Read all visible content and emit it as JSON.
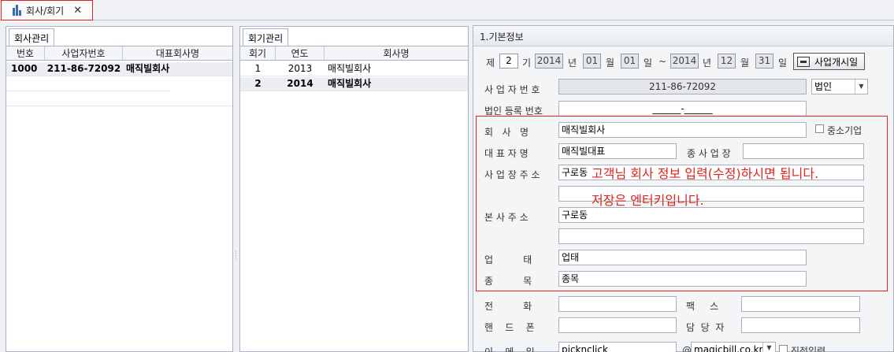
{
  "tab": {
    "label": "회사/회기",
    "close": "✕"
  },
  "company_panel": {
    "tab_label": "회사관리",
    "headers": [
      "번호",
      "사업자번호",
      "대표회사명"
    ],
    "rows": [
      {
        "no": "1000",
        "bizno": "211-86-72092",
        "name": "매직빌회사"
      }
    ]
  },
  "period_panel": {
    "tab_label": "회기관리",
    "headers": [
      "회기",
      "연도",
      "회사명"
    ],
    "rows": [
      {
        "period": "1",
        "year": "2013",
        "name": "매직빌회사"
      },
      {
        "period": "2",
        "year": "2014",
        "name": "매직빌회사"
      }
    ]
  },
  "info": {
    "section_title": "1.기본정보",
    "period_prefix": "제",
    "period_no": "2",
    "period_unit": "기",
    "start_year": "2014",
    "year_unit": "년",
    "start_month": "01",
    "month_unit": "월",
    "start_day": "01",
    "day_unit": "일",
    "tilde": "~",
    "end_year": "2014",
    "end_month": "12",
    "end_day": "31",
    "start_button": "사업개시일",
    "biz_no_label": "사 업 자 번 호",
    "biz_no": "211-86-72092",
    "corp_type": "법인",
    "corp_reg_label": "법인 등록 번호",
    "corp_reg_value": "______-______",
    "company_label": "회   사   명",
    "company_name": "매직빌회사",
    "sme_label": "중소기업",
    "ceo_label": "대 표 자 명",
    "ceo_name": "매직빌대표",
    "branch_label": "종 사 업 장",
    "branch_value": "",
    "biz_addr_label": "사 업 장 주 소",
    "biz_addr": "구로동",
    "biz_addr2": "",
    "hq_addr_label": "본 사 주 소",
    "hq_addr": "구로동",
    "hq_addr2": "",
    "biz_type_label": "업          태",
    "biz_type": "업태",
    "item_label": "종          목",
    "item": "종목",
    "phone_label": "전          화",
    "phone": "",
    "fax_label": "팩     스",
    "fax": "",
    "mobile_label": "핸    드    폰",
    "mobile": "",
    "manager_label": "담  당  자",
    "manager": "",
    "email_label": "이    메    일",
    "email_id": "picknclick",
    "email_at": "@",
    "email_domain": "magicbill.co.kr",
    "direct_label": "직접입력",
    "note_line1": "고객님 회사 정보 입력(수정)하시면 됩니다.",
    "note_line2": "저장은 엔터키입니다."
  },
  "colors": {
    "accent_red": "#e0231c",
    "border": "#a9b3c1"
  }
}
